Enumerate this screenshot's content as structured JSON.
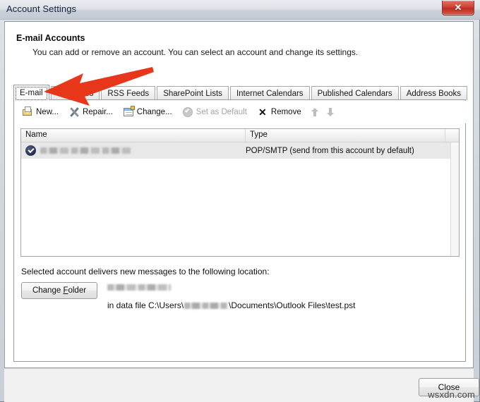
{
  "window": {
    "title": "Account Settings",
    "close_icon": "close-x-icon",
    "close_glyph": "✕"
  },
  "header": {
    "title": "E-mail Accounts",
    "subtitle": "You can add or remove an account. You can select an account and change its settings."
  },
  "tabs": [
    {
      "label": "E-mail",
      "active": true
    },
    {
      "label": "Data Files",
      "active": false
    },
    {
      "label": "RSS Feeds",
      "active": false
    },
    {
      "label": "SharePoint Lists",
      "active": false
    },
    {
      "label": "Internet Calendars",
      "active": false
    },
    {
      "label": "Published Calendars",
      "active": false
    },
    {
      "label": "Address Books",
      "active": false
    }
  ],
  "toolbar": {
    "new_label": "New...",
    "repair_label": "Repair...",
    "change_label": "Change...",
    "set_default_label": "Set as Default",
    "remove_label": "Remove",
    "remove_glyph": "✕",
    "move_up_icon": "arrow-up-icon",
    "move_down_icon": "arrow-down-icon"
  },
  "accounts_list": {
    "columns": [
      "Name",
      "Type"
    ],
    "rows": [
      {
        "name": "[redacted account name]",
        "type": "POP/SMTP (send from this account by default)",
        "is_default": true,
        "default_icon": "check-circle-icon"
      }
    ]
  },
  "delivery": {
    "label": "Selected account delivers new messages to the following location:",
    "change_folder_button": "Change Folder",
    "folder_name": "[redacted folder]",
    "data_file_prefix": "in data file C:\\Users\\",
    "data_file_user": "[redacted user]",
    "data_file_suffix": "\\Documents\\Outlook Files\\test.pst"
  },
  "footer": {
    "close_label": "Close"
  },
  "annotation": {
    "arrow_color": "#e8361a",
    "arrow_target": "E-mail tab"
  },
  "watermark": {
    "text": "wsxdn.com"
  }
}
